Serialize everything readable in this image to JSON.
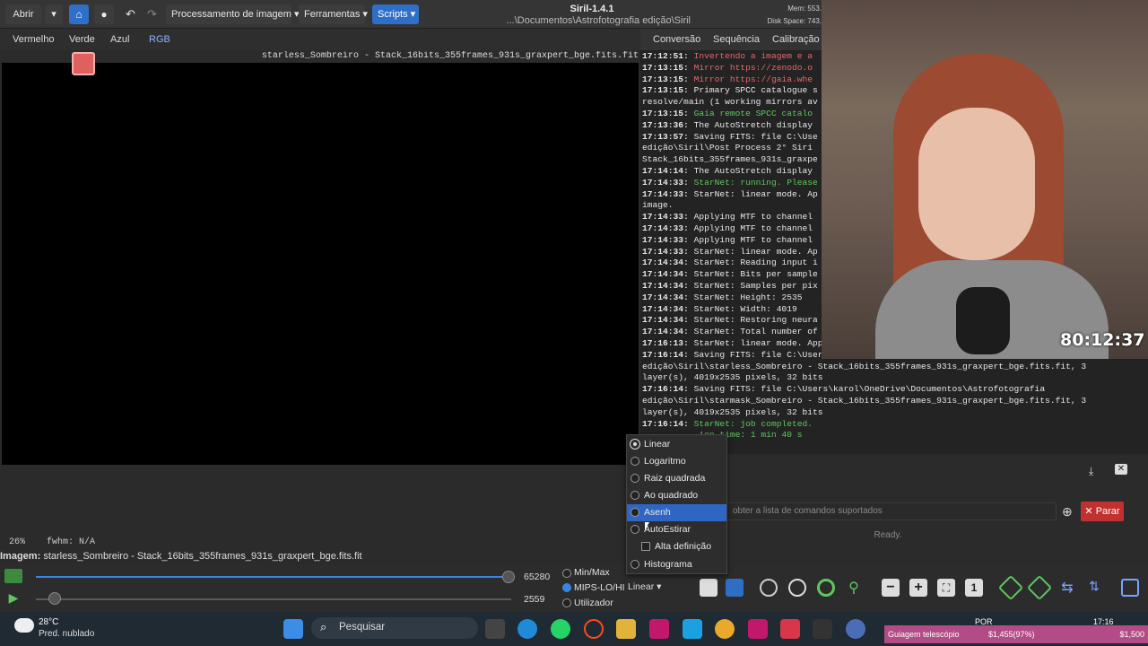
{
  "app": {
    "title": "Siril-1.4.1",
    "subtitle": "...\\Documentos\\Astrofotografia edição\\Siril",
    "mem": "Mem: 553.",
    "disk": "Disk Space: 743."
  },
  "toolbar": {
    "open": "Abrir",
    "menu_processing": "Processamento de imagem",
    "menu_tools": "Ferramentas",
    "menu_scripts": "Scripts"
  },
  "channels": [
    "Vermelho",
    "Verde",
    "Azul",
    "RGB"
  ],
  "image": {
    "filename": "starless_Sombreiro - Stack_16bits_355frames_931s_graxpert_bge.fits.fit",
    "zoom": "26%",
    "fwhm": "fwhm: N/A",
    "label_prefix": "Imagem:",
    "label_name": "starless_Sombreiro - Stack_16bits_355frames_931s_graxpert_bge.fits.fit"
  },
  "sliders": {
    "hi_value": "65280",
    "lo_value": "2559",
    "modes": [
      "Min/Max",
      "MIPS-LO/HI",
      "Utilizador"
    ],
    "selected_mode": "MIPS-LO/HI",
    "display_mode": "Linear"
  },
  "log_tabs": [
    "Conversão",
    "Sequência",
    "Calibração"
  ],
  "log": [
    {
      "t": "17:12:51:",
      "c": "red",
      "m": " Invertendo a imagem e a"
    },
    {
      "t": "17:13:15:",
      "c": "red",
      "m": " Mirror https://zenodo.o"
    },
    {
      "t": "17:13:15:",
      "c": "red",
      "m": " Mirror https://gaia.whe"
    },
    {
      "t": "17:13:15:",
      "c": "white",
      "m": " Primary SPCC catalogue s"
    },
    {
      "t": "",
      "c": "white",
      "m": "resolve/main (1 working mirrors av"
    },
    {
      "t": "17:13:15:",
      "c": "green",
      "m": " Gaia remote SPCC catalo"
    },
    {
      "t": "17:13:36:",
      "c": "white",
      "m": " The AutoStretch display"
    },
    {
      "t": "17:13:57:",
      "c": "white",
      "m": " Saving FITS: file C:\\Use"
    },
    {
      "t": "",
      "c": "white",
      "m": "edição\\Siril\\Post Process 2° Siri"
    },
    {
      "t": "",
      "c": "white",
      "m": "Stack_16bits_355frames_931s_graxpe"
    },
    {
      "t": "17:14:14:",
      "c": "white",
      "m": " The AutoStretch display"
    },
    {
      "t": "17:14:33:",
      "c": "green",
      "m": " StarNet: running. Please"
    },
    {
      "t": "17:14:33:",
      "c": "white",
      "m": " StarNet: linear mode. Ap"
    },
    {
      "t": "",
      "c": "white",
      "m": "image."
    },
    {
      "t": "17:14:33:",
      "c": "white",
      "m": " Applying MTF to channel"
    },
    {
      "t": "17:14:33:",
      "c": "white",
      "m": " Applying MTF to channel"
    },
    {
      "t": "17:14:33:",
      "c": "white",
      "m": " Applying MTF to channel"
    },
    {
      "t": "17:14:33:",
      "c": "white",
      "m": " StarNet: linear mode. Ap"
    },
    {
      "t": "17:14:34:",
      "c": "white",
      "m": " StarNet: Reading input i"
    },
    {
      "t": "17:14:34:",
      "c": "white",
      "m": " StarNet: Bits per sample"
    },
    {
      "t": "17:14:34:",
      "c": "white",
      "m": " StarNet: Samples per pix"
    },
    {
      "t": "17:14:34:",
      "c": "white",
      "m": " StarNet: Height: 2535"
    },
    {
      "t": "17:14:34:",
      "c": "white",
      "m": " StarNet: Width: 4019"
    },
    {
      "t": "17:14:34:",
      "c": "white",
      "m": " StarNet: Restoring neura"
    },
    {
      "t": "17:14:34:",
      "c": "white",
      "m": " StarNet: Total number of"
    },
    {
      "t": "17:16:13:",
      "c": "white",
      "m": " StarNet: linear mode. Applying inverse autostretch to starless image."
    },
    {
      "t": "17:16:14:",
      "c": "white",
      "m": " Saving FITS: file C:\\Users\\karol\\OneDrive\\Documentos\\Astrofotografia"
    },
    {
      "t": "",
      "c": "white",
      "m": "edição\\Siril\\starless_Sombreiro - Stack_16bits_355frames_931s_graxpert_bge.fits.fit, 3"
    },
    {
      "t": "",
      "c": "white",
      "m": "layer(s), 4019x2535 pixels, 32 bits"
    },
    {
      "t": "17:16:14:",
      "c": "white",
      "m": " Saving FITS: file C:\\Users\\karol\\OneDrive\\Documentos\\Astrofotografia"
    },
    {
      "t": "",
      "c": "white",
      "m": "edição\\Siril\\starmask_Sombreiro - Stack_16bits_355frames_931s_graxpert_bge.fits.fit, 3"
    },
    {
      "t": "",
      "c": "white",
      "m": "layer(s), 4019x2535 pixels, 32 bits"
    },
    {
      "t": "17:16:14:",
      "c": "green",
      "m": " StarNet: job completed."
    },
    {
      "t": "",
      "c": "green",
      "m": "           ion time: 1 min 40 s"
    }
  ],
  "command": {
    "placeholder": "obter a lista de comandos suportados",
    "stop": "Parar",
    "status": "Ready."
  },
  "dropdown": {
    "options": [
      "Linear",
      "Logaritmo",
      "Raiz quadrada",
      "Ao quadrado",
      "Asenh",
      "AutoEstirar",
      "Alta definição",
      "Histograma"
    ],
    "checked": "Linear",
    "highlighted": "Asenh"
  },
  "webcam": {
    "timer": "80:12:37"
  },
  "taskbar": {
    "temp": "28°C",
    "weather": "Pred. nublado",
    "search": "Pesquisar",
    "guide_label": "Guiagem telescópio",
    "guide_value": "$1,455(97%)",
    "guide_total": "$1,500",
    "lang": "POR",
    "time": "17:16"
  },
  "colors": {
    "accent": "#2f66c3",
    "stop": "#c0312f",
    "log_red": "#e8676b",
    "log_green": "#5fc65f"
  }
}
